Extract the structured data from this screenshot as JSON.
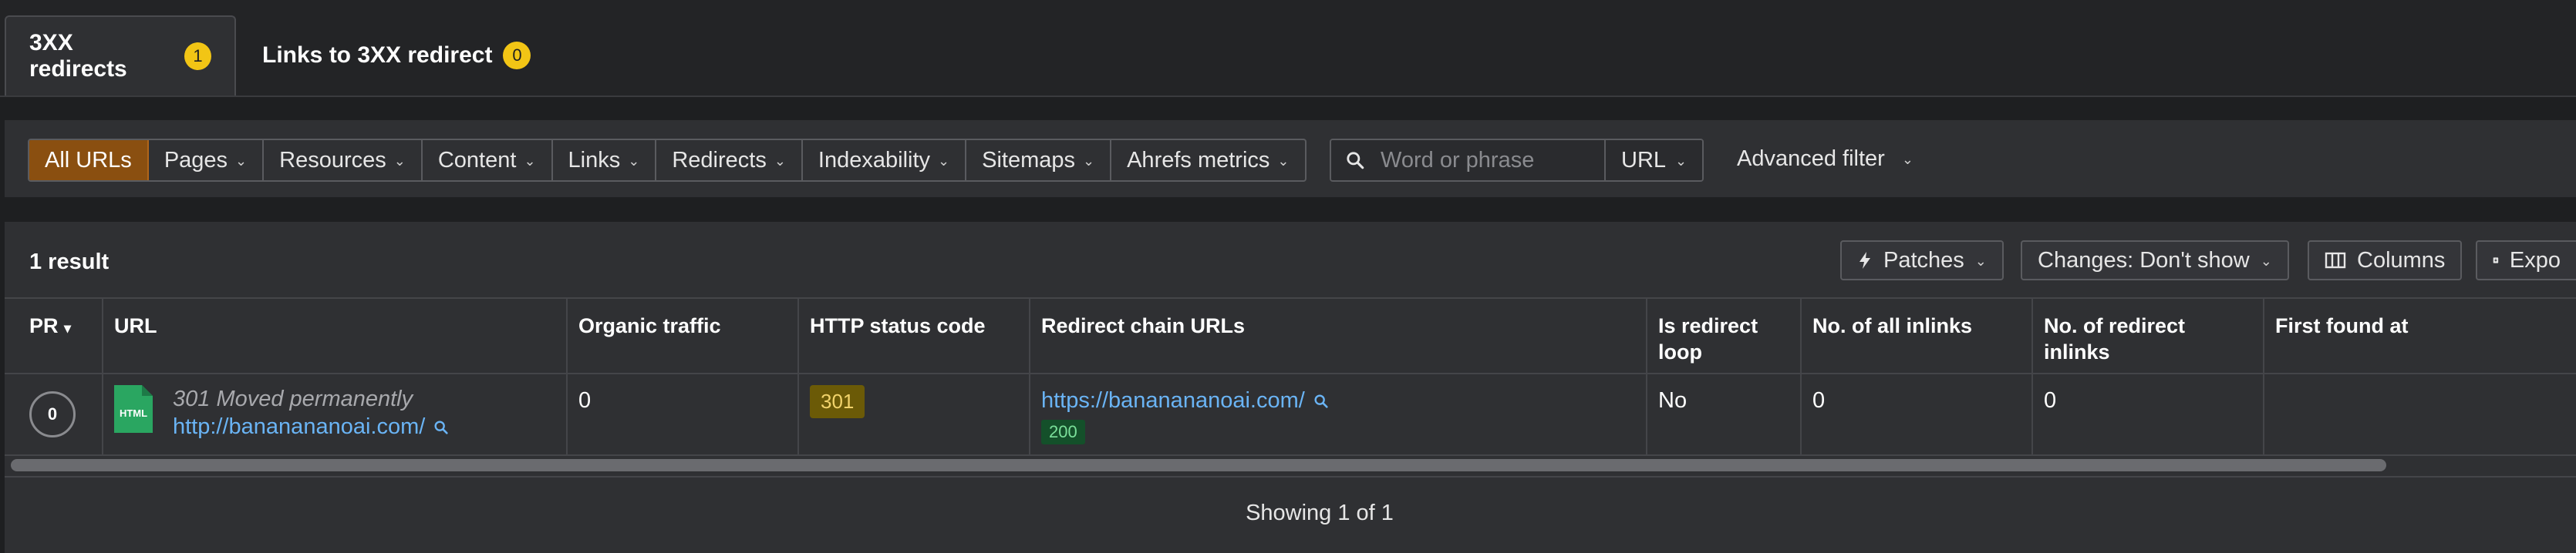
{
  "tabs": [
    {
      "label": "3XX redirects",
      "count": "1"
    },
    {
      "label": "Links to 3XX redirect",
      "count": "0"
    }
  ],
  "filters": {
    "segments": [
      "All URLs",
      "Pages",
      "Resources",
      "Content",
      "Links",
      "Redirects",
      "Indexability",
      "Sitemaps",
      "Ahrefs metrics"
    ],
    "active_segment": "All URLs",
    "search_placeholder": "Word or phrase",
    "search_value": "",
    "search_scope": "URL",
    "advanced_filter": "Advanced filter"
  },
  "results": {
    "count_label": "1 result",
    "toolbar": {
      "patches": "Patches",
      "changes": "Changes: Don't show",
      "columns": "Columns",
      "export": "Expo"
    },
    "columns": [
      "PR",
      "URL",
      "Organic traffic",
      "HTTP status code",
      "Redirect chain URLs",
      "Is redirect loop",
      "No. of all inlinks",
      "No. of redirect inlinks",
      "First found at"
    ],
    "rows": [
      {
        "pr": "0",
        "file_type": "HTML",
        "status_text": "301 Moved permanently",
        "url": "http://bananananoai.com/",
        "organic_traffic": "0",
        "http_status": "301",
        "redirect_url": "https://bananananoai.com/",
        "redirect_status": "200",
        "is_loop": "No",
        "all_inlinks": "0",
        "redirect_inlinks": "0",
        "first_found": ""
      }
    ],
    "pagination": "Showing 1 of 1"
  },
  "colors": {
    "active_filter": "#8a4f10",
    "badge": "#f2c515",
    "link": "#6ab4f5",
    "status_301_bg": "#6b5a07",
    "status_200_bg": "#14502a",
    "html_icon": "#2aa661"
  }
}
